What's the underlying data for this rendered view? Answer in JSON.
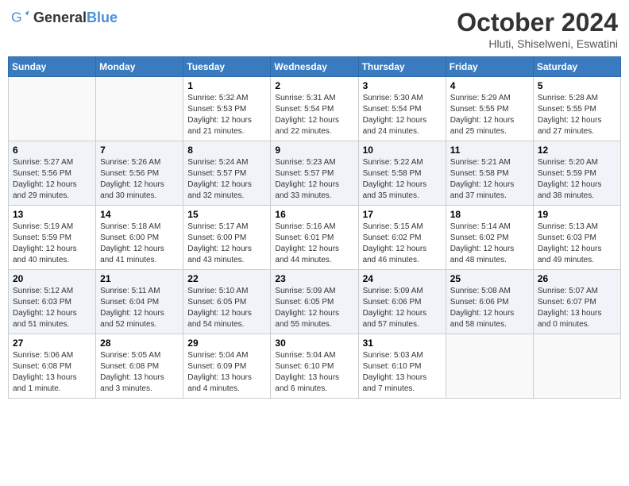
{
  "header": {
    "logo_general": "General",
    "logo_blue": "Blue",
    "month_year": "October 2024",
    "location": "Hluti, Shiselweni, Eswatini"
  },
  "columns": [
    "Sunday",
    "Monday",
    "Tuesday",
    "Wednesday",
    "Thursday",
    "Friday",
    "Saturday"
  ],
  "weeks": [
    [
      {
        "day": "",
        "sunrise": "",
        "sunset": "",
        "daylight": ""
      },
      {
        "day": "",
        "sunrise": "",
        "sunset": "",
        "daylight": ""
      },
      {
        "day": "1",
        "sunrise": "Sunrise: 5:32 AM",
        "sunset": "Sunset: 5:53 PM",
        "daylight": "Daylight: 12 hours and 21 minutes."
      },
      {
        "day": "2",
        "sunrise": "Sunrise: 5:31 AM",
        "sunset": "Sunset: 5:54 PM",
        "daylight": "Daylight: 12 hours and 22 minutes."
      },
      {
        "day": "3",
        "sunrise": "Sunrise: 5:30 AM",
        "sunset": "Sunset: 5:54 PM",
        "daylight": "Daylight: 12 hours and 24 minutes."
      },
      {
        "day": "4",
        "sunrise": "Sunrise: 5:29 AM",
        "sunset": "Sunset: 5:55 PM",
        "daylight": "Daylight: 12 hours and 25 minutes."
      },
      {
        "day": "5",
        "sunrise": "Sunrise: 5:28 AM",
        "sunset": "Sunset: 5:55 PM",
        "daylight": "Daylight: 12 hours and 27 minutes."
      }
    ],
    [
      {
        "day": "6",
        "sunrise": "Sunrise: 5:27 AM",
        "sunset": "Sunset: 5:56 PM",
        "daylight": "Daylight: 12 hours and 29 minutes."
      },
      {
        "day": "7",
        "sunrise": "Sunrise: 5:26 AM",
        "sunset": "Sunset: 5:56 PM",
        "daylight": "Daylight: 12 hours and 30 minutes."
      },
      {
        "day": "8",
        "sunrise": "Sunrise: 5:24 AM",
        "sunset": "Sunset: 5:57 PM",
        "daylight": "Daylight: 12 hours and 32 minutes."
      },
      {
        "day": "9",
        "sunrise": "Sunrise: 5:23 AM",
        "sunset": "Sunset: 5:57 PM",
        "daylight": "Daylight: 12 hours and 33 minutes."
      },
      {
        "day": "10",
        "sunrise": "Sunrise: 5:22 AM",
        "sunset": "Sunset: 5:58 PM",
        "daylight": "Daylight: 12 hours and 35 minutes."
      },
      {
        "day": "11",
        "sunrise": "Sunrise: 5:21 AM",
        "sunset": "Sunset: 5:58 PM",
        "daylight": "Daylight: 12 hours and 37 minutes."
      },
      {
        "day": "12",
        "sunrise": "Sunrise: 5:20 AM",
        "sunset": "Sunset: 5:59 PM",
        "daylight": "Daylight: 12 hours and 38 minutes."
      }
    ],
    [
      {
        "day": "13",
        "sunrise": "Sunrise: 5:19 AM",
        "sunset": "Sunset: 5:59 PM",
        "daylight": "Daylight: 12 hours and 40 minutes."
      },
      {
        "day": "14",
        "sunrise": "Sunrise: 5:18 AM",
        "sunset": "Sunset: 6:00 PM",
        "daylight": "Daylight: 12 hours and 41 minutes."
      },
      {
        "day": "15",
        "sunrise": "Sunrise: 5:17 AM",
        "sunset": "Sunset: 6:00 PM",
        "daylight": "Daylight: 12 hours and 43 minutes."
      },
      {
        "day": "16",
        "sunrise": "Sunrise: 5:16 AM",
        "sunset": "Sunset: 6:01 PM",
        "daylight": "Daylight: 12 hours and 44 minutes."
      },
      {
        "day": "17",
        "sunrise": "Sunrise: 5:15 AM",
        "sunset": "Sunset: 6:02 PM",
        "daylight": "Daylight: 12 hours and 46 minutes."
      },
      {
        "day": "18",
        "sunrise": "Sunrise: 5:14 AM",
        "sunset": "Sunset: 6:02 PM",
        "daylight": "Daylight: 12 hours and 48 minutes."
      },
      {
        "day": "19",
        "sunrise": "Sunrise: 5:13 AM",
        "sunset": "Sunset: 6:03 PM",
        "daylight": "Daylight: 12 hours and 49 minutes."
      }
    ],
    [
      {
        "day": "20",
        "sunrise": "Sunrise: 5:12 AM",
        "sunset": "Sunset: 6:03 PM",
        "daylight": "Daylight: 12 hours and 51 minutes."
      },
      {
        "day": "21",
        "sunrise": "Sunrise: 5:11 AM",
        "sunset": "Sunset: 6:04 PM",
        "daylight": "Daylight: 12 hours and 52 minutes."
      },
      {
        "day": "22",
        "sunrise": "Sunrise: 5:10 AM",
        "sunset": "Sunset: 6:05 PM",
        "daylight": "Daylight: 12 hours and 54 minutes."
      },
      {
        "day": "23",
        "sunrise": "Sunrise: 5:09 AM",
        "sunset": "Sunset: 6:05 PM",
        "daylight": "Daylight: 12 hours and 55 minutes."
      },
      {
        "day": "24",
        "sunrise": "Sunrise: 5:09 AM",
        "sunset": "Sunset: 6:06 PM",
        "daylight": "Daylight: 12 hours and 57 minutes."
      },
      {
        "day": "25",
        "sunrise": "Sunrise: 5:08 AM",
        "sunset": "Sunset: 6:06 PM",
        "daylight": "Daylight: 12 hours and 58 minutes."
      },
      {
        "day": "26",
        "sunrise": "Sunrise: 5:07 AM",
        "sunset": "Sunset: 6:07 PM",
        "daylight": "Daylight: 13 hours and 0 minutes."
      }
    ],
    [
      {
        "day": "27",
        "sunrise": "Sunrise: 5:06 AM",
        "sunset": "Sunset: 6:08 PM",
        "daylight": "Daylight: 13 hours and 1 minute."
      },
      {
        "day": "28",
        "sunrise": "Sunrise: 5:05 AM",
        "sunset": "Sunset: 6:08 PM",
        "daylight": "Daylight: 13 hours and 3 minutes."
      },
      {
        "day": "29",
        "sunrise": "Sunrise: 5:04 AM",
        "sunset": "Sunset: 6:09 PM",
        "daylight": "Daylight: 13 hours and 4 minutes."
      },
      {
        "day": "30",
        "sunrise": "Sunrise: 5:04 AM",
        "sunset": "Sunset: 6:10 PM",
        "daylight": "Daylight: 13 hours and 6 minutes."
      },
      {
        "day": "31",
        "sunrise": "Sunrise: 5:03 AM",
        "sunset": "Sunset: 6:10 PM",
        "daylight": "Daylight: 13 hours and 7 minutes."
      },
      {
        "day": "",
        "sunrise": "",
        "sunset": "",
        "daylight": ""
      },
      {
        "day": "",
        "sunrise": "",
        "sunset": "",
        "daylight": ""
      }
    ]
  ]
}
